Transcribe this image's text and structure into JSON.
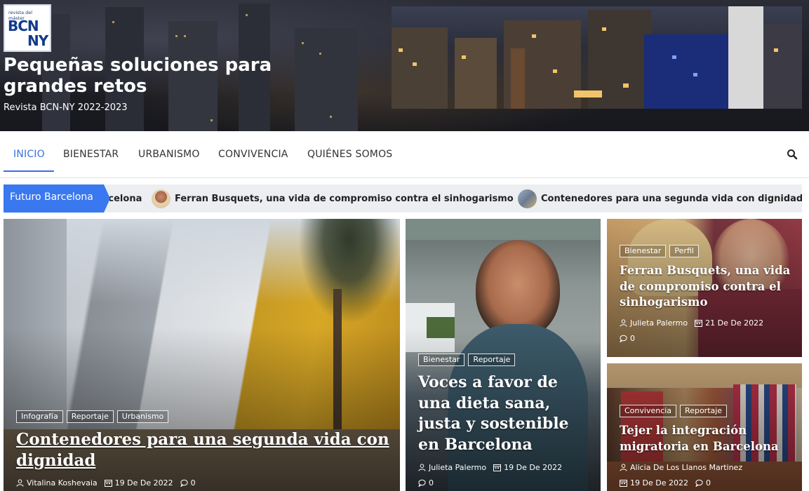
{
  "site": {
    "logo_top": "revista del máster",
    "logo_line1": "BCN",
    "logo_line2": "NY",
    "title": "Pequeñas soluciones para grandes retos",
    "tagline": "Revista BCN-NY 2022-2023"
  },
  "nav": {
    "items": [
      {
        "label": "INICIO",
        "active": true
      },
      {
        "label": "BIENESTAR"
      },
      {
        "label": "URBANISMO"
      },
      {
        "label": "CONVIVENCIA"
      },
      {
        "label": "QUIÉNES SOMOS"
      }
    ],
    "search_icon": "search-icon"
  },
  "ticker": {
    "label": "Futuro Barcelona",
    "items": [
      {
        "title": "rcelona"
      },
      {
        "title": "Ferran Busquets, una vida de compromiso contra el sinhogarismo"
      },
      {
        "title": "Contenedores para una segunda vida con dignidad"
      }
    ]
  },
  "posts": [
    {
      "tags": [
        "Infografía",
        "Reportaje",
        "Urbanismo"
      ],
      "title": "Contenedores para una segunda vida con dignidad",
      "author": "Vitalina Koshevaia",
      "date": "19 De De 2022",
      "comments": "0"
    },
    {
      "tags": [
        "Bienestar",
        "Reportaje"
      ],
      "title": "Voces a favor de una dieta sana, justa y sostenible en Barcelona",
      "author": "Julieta Palermo",
      "date": "19 De De 2022",
      "comments": "0"
    },
    {
      "tags": [
        "Bienestar",
        "Perfil"
      ],
      "title": "Ferran Busquets, una vida de compromiso contra el sinhogarismo",
      "author": "Julieta Palermo",
      "date": "21 De De 2022",
      "comments": "0"
    },
    {
      "tags": [
        "Convivencia",
        "Reportaje"
      ],
      "title": "Tejer la integración migratoria en Barcelona",
      "author": "Alicia De Los Llanos Martinez",
      "date": "19 De De 2022",
      "comments": "0"
    }
  ],
  "colors": {
    "accent": "#3a6fe0",
    "ticker_label_bg": "#3a78f0",
    "ticker_bg": "#eceef1"
  }
}
